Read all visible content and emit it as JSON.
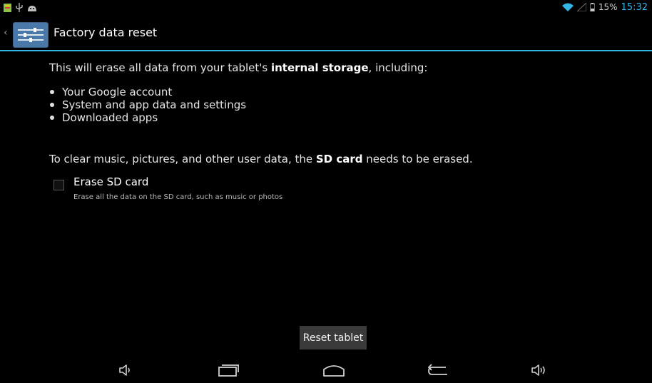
{
  "status_bar": {
    "battery_percent": "15%",
    "time": "15:32",
    "left_icons": [
      "notification-icon",
      "usb-icon",
      "android-icon"
    ],
    "right_icons": [
      "wifi-icon",
      "signal-icon",
      "battery-icon"
    ]
  },
  "header": {
    "title": "Factory data reset",
    "icon": "settings-icon"
  },
  "main": {
    "intro_prefix": "This will erase all data from your tablet's ",
    "intro_bold": "internal storage",
    "intro_suffix": ", including:",
    "items": [
      "Your Google account",
      "System and app data and settings",
      "Downloaded apps"
    ],
    "sd_prefix": "To clear music, pictures, and other user data, the ",
    "sd_bold": "SD card",
    "sd_suffix": " needs to be erased.",
    "erase_option": {
      "title": "Erase SD card",
      "subtitle": "Erase all the data on the SD card, such as music or photos",
      "checked": false
    },
    "reset_button": "Reset tablet"
  },
  "nav_bar": {
    "buttons": [
      "volume-down-icon",
      "recent-apps-icon",
      "home-icon",
      "back-icon",
      "volume-up-icon"
    ]
  },
  "colors": {
    "accent": "#33b5e5",
    "background": "#000000",
    "button": "#3a3a3a"
  }
}
